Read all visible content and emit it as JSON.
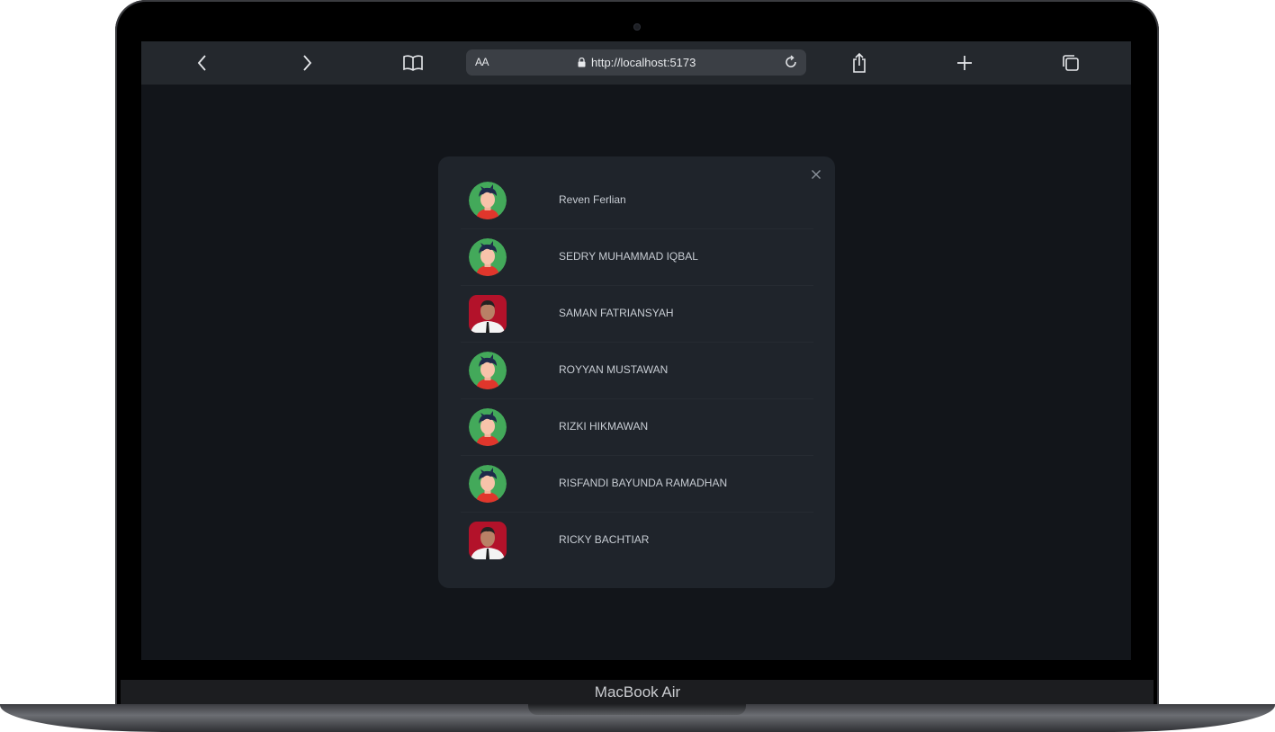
{
  "browser": {
    "reader_label": "AA",
    "url": "http://localhost:5173"
  },
  "users": [
    {
      "name": "Reven Ferlian",
      "avatar": "cartoon"
    },
    {
      "name": "SEDRY MUHAMMAD IQBAL",
      "avatar": "cartoon"
    },
    {
      "name": "SAMAN FATRIANSYAH",
      "avatar": "photo-red"
    },
    {
      "name": "ROYYAN MUSTAWAN",
      "avatar": "cartoon"
    },
    {
      "name": "RIZKI HIKMAWAN",
      "avatar": "cartoon"
    },
    {
      "name": "RISFANDI BAYUNDA RAMADHAN",
      "avatar": "cartoon"
    },
    {
      "name": "RICKY BACHTIAR",
      "avatar": "photo-red"
    }
  ],
  "device": {
    "label": "MacBook Air"
  },
  "colors": {
    "screen_bg": "#12151a",
    "modal_bg": "#1f242b",
    "toolbar_bg": "#24282d",
    "avatar_green": "#43a95a",
    "avatar_shirt": "#e0362c"
  }
}
